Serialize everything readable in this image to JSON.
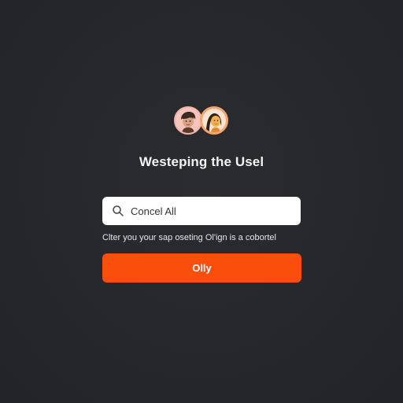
{
  "title": "Westeping the Usel",
  "search": {
    "icon": "search-icon",
    "value": "Concel All",
    "placeholder": "Concel All"
  },
  "helper_text": "Clter you your sap oseting Ol'ign is a cobortel",
  "primary_button": {
    "label": "Olly",
    "color": "#fa4f0c"
  },
  "avatars": [
    {
      "icon": "user-avatar-icon"
    },
    {
      "icon": "user-avatar-icon"
    }
  ],
  "colors": {
    "background": "#26282c",
    "accent": "#fa4f0c",
    "text": "#f3f3f3"
  }
}
